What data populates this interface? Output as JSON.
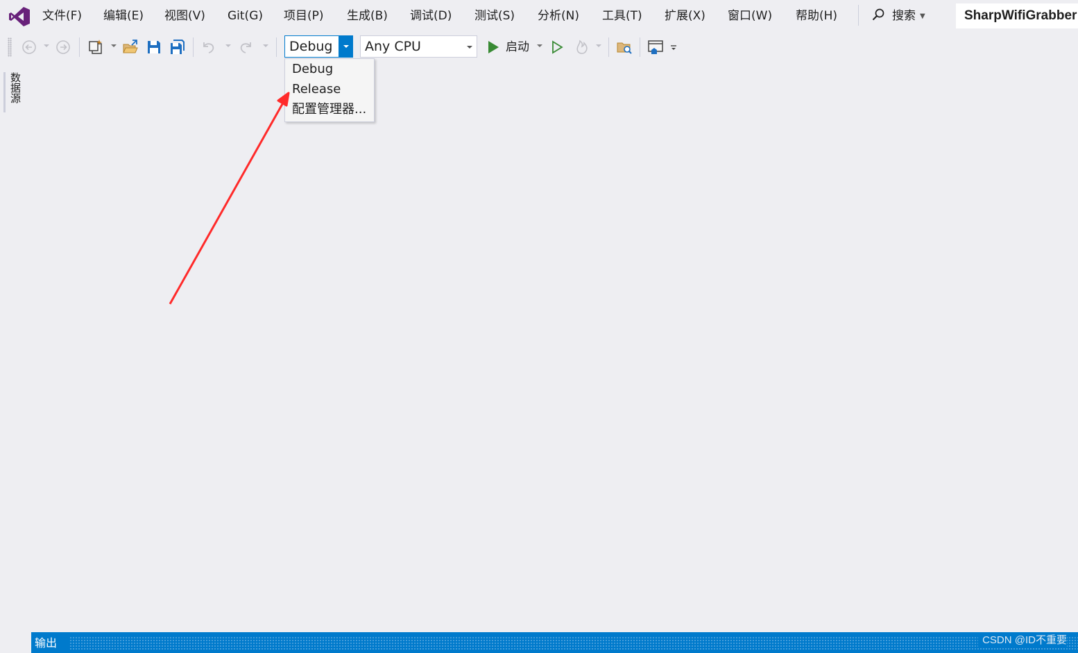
{
  "menu": {
    "items": [
      "文件(F)",
      "编辑(E)",
      "视图(V)",
      "Git(G)",
      "项目(P)",
      "生成(B)",
      "调试(D)",
      "测试(S)",
      "分析(N)",
      "工具(T)",
      "扩展(X)",
      "窗口(W)",
      "帮助(H)"
    ],
    "search_label": "搜索",
    "solution_name": "SharpWifiGrabber"
  },
  "toolbar": {
    "configuration": "Debug",
    "platform": "Any CPU",
    "start_label": "启动"
  },
  "config_dropdown": {
    "options": [
      "Debug",
      "Release",
      "配置管理器..."
    ]
  },
  "side_tab": {
    "label": "数据源"
  },
  "statusbar": {
    "panel_label": "输出",
    "watermark": "CSDN @ID不重要"
  },
  "colors": {
    "accent": "#007acc",
    "background": "#eeeef2",
    "annotation_arrow": "#ff2a2a",
    "start_green": "#388a34",
    "vs_purple": "#68217a"
  },
  "icons": [
    "vs-logo-icon",
    "search-icon",
    "back-icon",
    "forward-icon",
    "new-project-icon",
    "open-folder-icon",
    "save-icon",
    "save-all-icon",
    "undo-icon",
    "redo-icon",
    "start-icon",
    "start-without-debugging-icon",
    "hot-reload-icon",
    "solution-explorer-icon",
    "browser-link-icon",
    "toolbar-overflow-icon"
  ]
}
